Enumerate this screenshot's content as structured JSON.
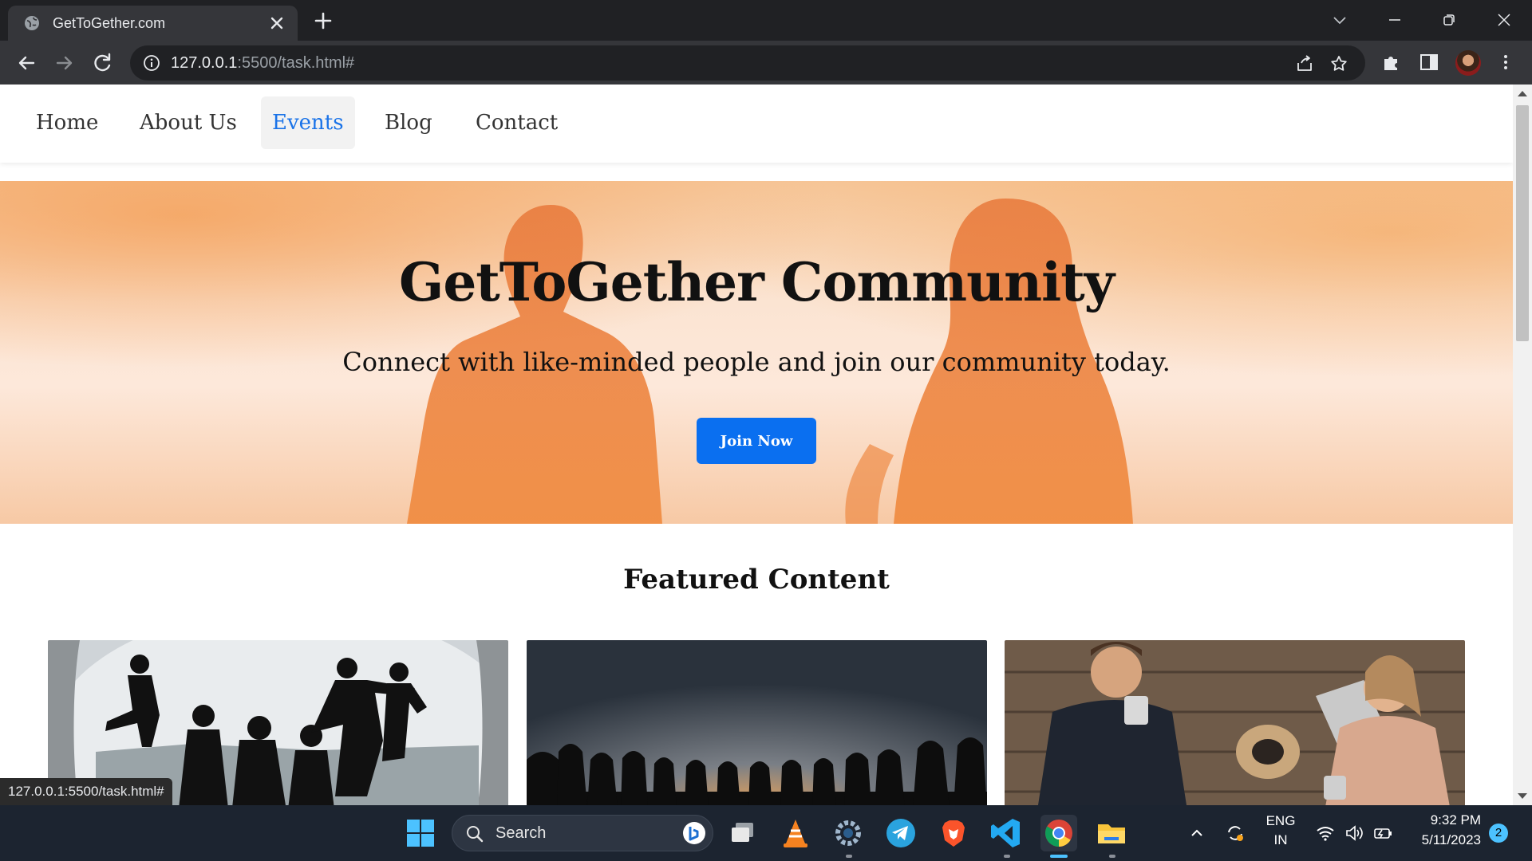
{
  "browser": {
    "tab_title": "GetToGether.com",
    "url_host": "127.0.0.1",
    "url_rest": ":5500/task.html#",
    "status_url": "127.0.0.1:5500/task.html#"
  },
  "site": {
    "nav": {
      "items": [
        {
          "label": "Home",
          "active": false
        },
        {
          "label": "About Us",
          "active": false
        },
        {
          "label": "Events",
          "active": true
        },
        {
          "label": "Blog",
          "active": false
        },
        {
          "label": "Contact",
          "active": false
        }
      ]
    },
    "hero": {
      "title": "GetToGether Community",
      "subtitle": "Connect with like-minded people and join our community today.",
      "cta_label": "Join Now"
    },
    "featured": {
      "title": "Featured Content",
      "cards": [
        {
          "image": "silhouettes-jumping-photo"
        },
        {
          "image": "crowd-sunset-photo"
        },
        {
          "image": "couple-with-pug-photo"
        }
      ]
    },
    "colors": {
      "accent": "#1a73e8",
      "button": "#0a6ff0"
    }
  },
  "taskbar": {
    "search_label": "Search",
    "language": "ENG",
    "region": "IN",
    "time": "9:32 PM",
    "date": "5/11/2023",
    "notification_count": "2"
  }
}
